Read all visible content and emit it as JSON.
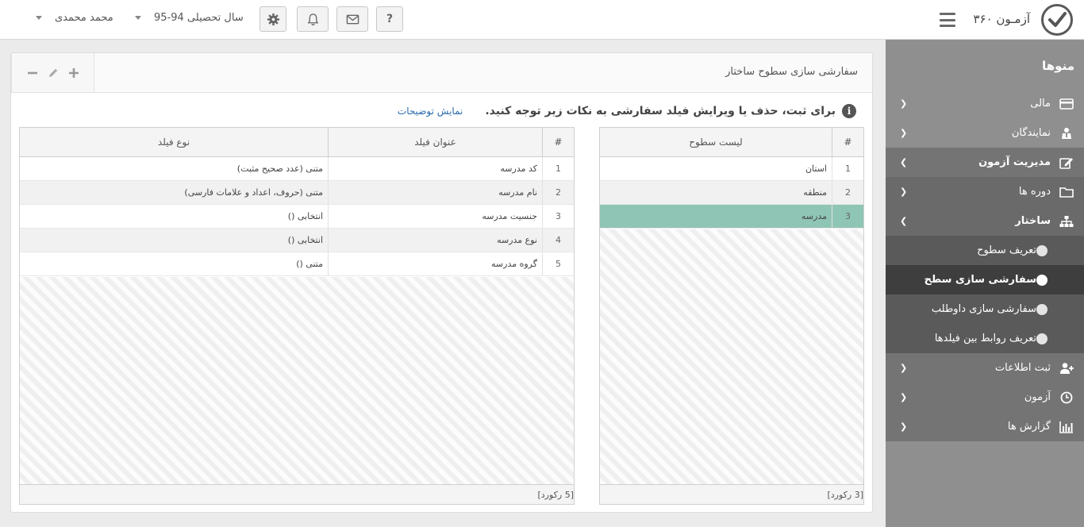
{
  "header": {
    "app_title": "آزمـون ۳۶۰",
    "help_label": "?",
    "academic_year": "سال تحصیلی 94-95",
    "user_name": "محمد محمدی"
  },
  "sidebar": {
    "heading": "منوها",
    "items": [
      {
        "label": "مالی",
        "icon": "credit-card-icon"
      },
      {
        "label": "نمایندگان",
        "icon": "agent-icon"
      },
      {
        "label": "مدیریت آزمون",
        "icon": "edit-icon"
      },
      {
        "label": "دوره ها",
        "icon": "folder-icon"
      },
      {
        "label": "ساختار",
        "icon": "sitemap-icon"
      },
      {
        "label": "تعریف سطوح"
      },
      {
        "label": "سفارشی سازی سطح"
      },
      {
        "label": "سفارشی سازی داوطلب"
      },
      {
        "label": "تعریف روابط بین فیلدها"
      },
      {
        "label": "ثبت اطلاعات",
        "icon": "user-plus-icon"
      },
      {
        "label": "آزمون",
        "icon": "clock-icon"
      },
      {
        "label": "گزارش ها",
        "icon": "bar-chart-icon"
      }
    ]
  },
  "panel": {
    "title": "سفارشی سازی سطوح ساختار",
    "notice": "برای ثبت، حذف یا ویرایش فیلد سفارشی به نکات زیر توجه کنید.",
    "show_help": "نمایش توضیحات"
  },
  "levels_grid": {
    "col_num": "#",
    "col_name": "لیست سطوح",
    "rows": [
      {
        "num": "1",
        "name": "استان"
      },
      {
        "num": "2",
        "name": "منطقه"
      },
      {
        "num": "3",
        "name": "مدرسه"
      }
    ],
    "footer": "[3 رکورد]"
  },
  "fields_grid": {
    "col_num": "#",
    "col_title": "عنوان فیلد",
    "col_type": "نوع فیلد",
    "rows": [
      {
        "num": "1",
        "title": "کد مدرسه",
        "type": "متنی (عدد صحیح مثبت)"
      },
      {
        "num": "2",
        "title": "نام مدرسه",
        "type": "متنی (حروف، اعداد و علامات فارسی)"
      },
      {
        "num": "3",
        "title": "جنسیت مدرسه",
        "type": "انتخابی ()"
      },
      {
        "num": "4",
        "title": "نوع مدرسه",
        "type": "انتخابی ()"
      },
      {
        "num": "5",
        "title": "گروه مدرسه",
        "type": "متنی ()"
      }
    ],
    "footer": "[5 رکورد]"
  },
  "colors": {
    "selected_row": "#8fc5b4",
    "sidebar_bg": "#8f8f8f",
    "sidebar_current": "#3e3e3e"
  }
}
